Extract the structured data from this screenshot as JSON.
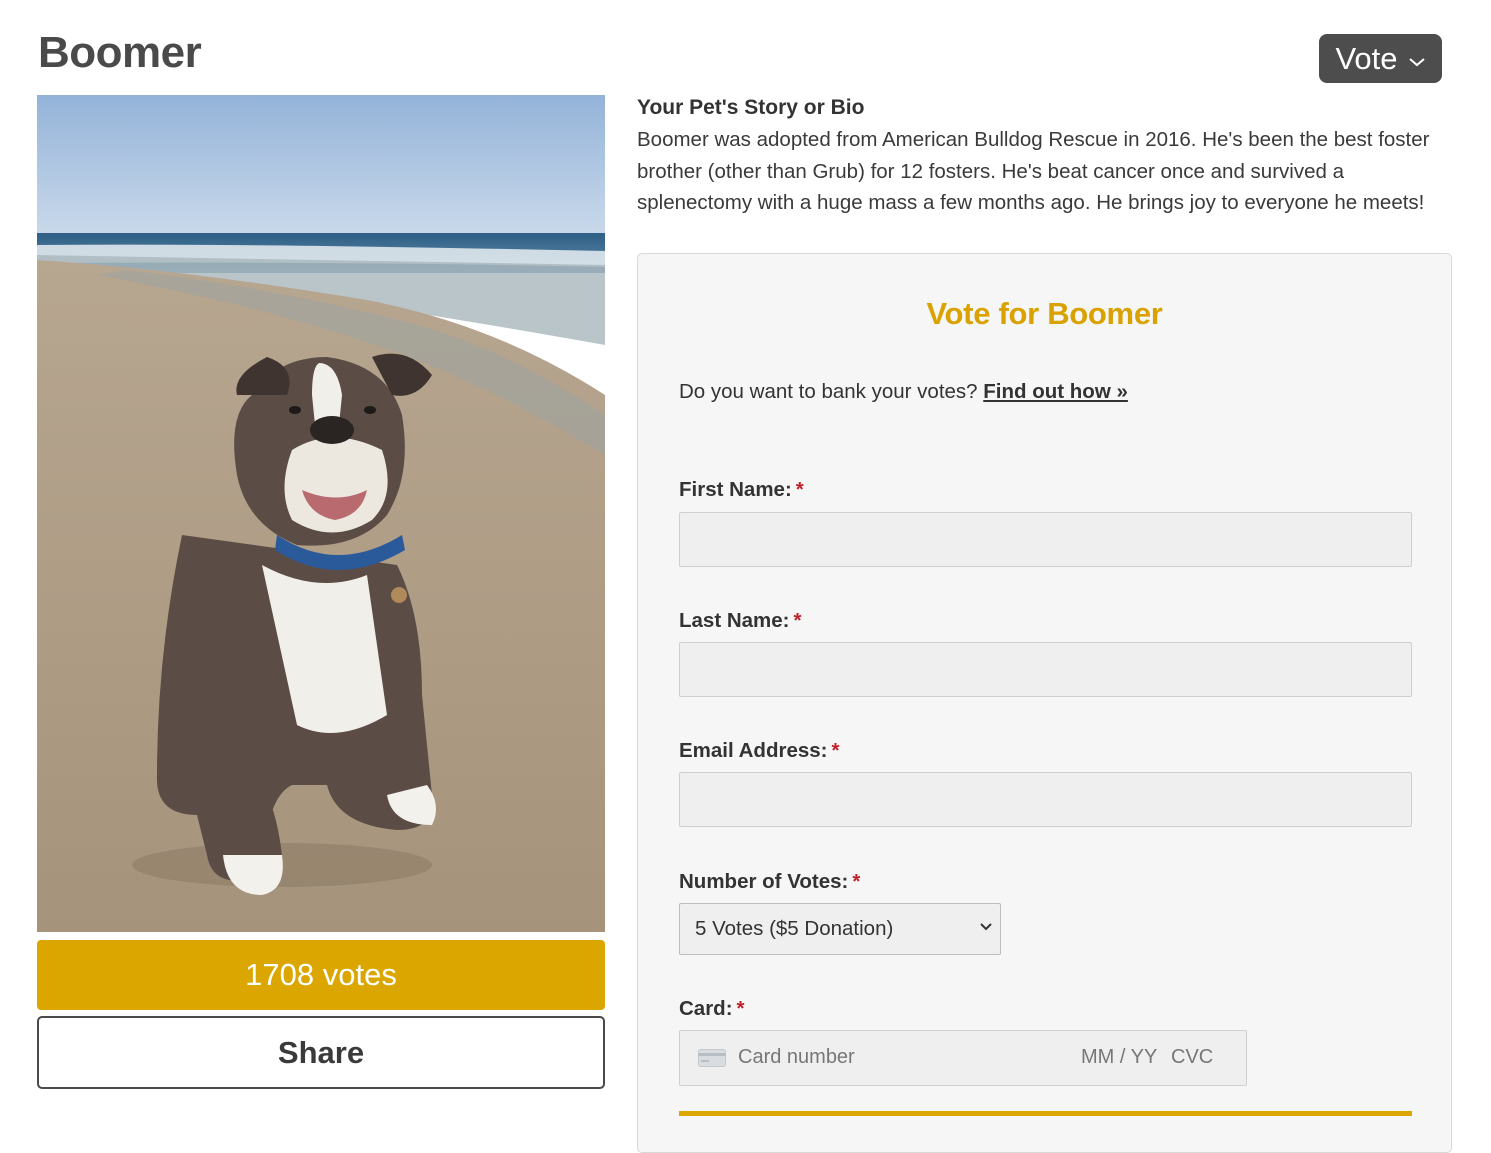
{
  "page": {
    "title": "Boomer"
  },
  "header": {
    "vote_button_label": "Vote"
  },
  "pet": {
    "votes_label": "1708 votes",
    "share_label": "Share"
  },
  "bio": {
    "heading": "Your Pet's Story or Bio",
    "text": "Boomer was adopted from American Bulldog Rescue in 2016. He's been the best foster brother (other than Grub) for 12 fosters. He's beat cancer once and survived a splenectomy with a huge mass a few months ago. He brings joy to everyone he meets!"
  },
  "form": {
    "title": "Vote for Boomer",
    "bank_text": "Do you want to bank your votes?",
    "bank_link": "Find out how »",
    "required_mark": "*",
    "first_name_label": "First Name:",
    "last_name_label": "Last Name:",
    "email_label": "Email Address:",
    "votes_label": "Number of Votes:",
    "votes_selected": "5 Votes ($5 Donation)",
    "card_label": "Card:",
    "card_number_placeholder": "Card number",
    "card_expiry_placeholder": "MM / YY",
    "card_cvc_placeholder": "CVC"
  },
  "colors": {
    "accent": "#dba600",
    "dark_button": "#4d4d4d",
    "required": "#c0202a"
  },
  "icons": {
    "vote_dropdown": "chevron-down-icon",
    "select_dropdown": "chevron-down-icon",
    "card": "credit-card-icon"
  }
}
